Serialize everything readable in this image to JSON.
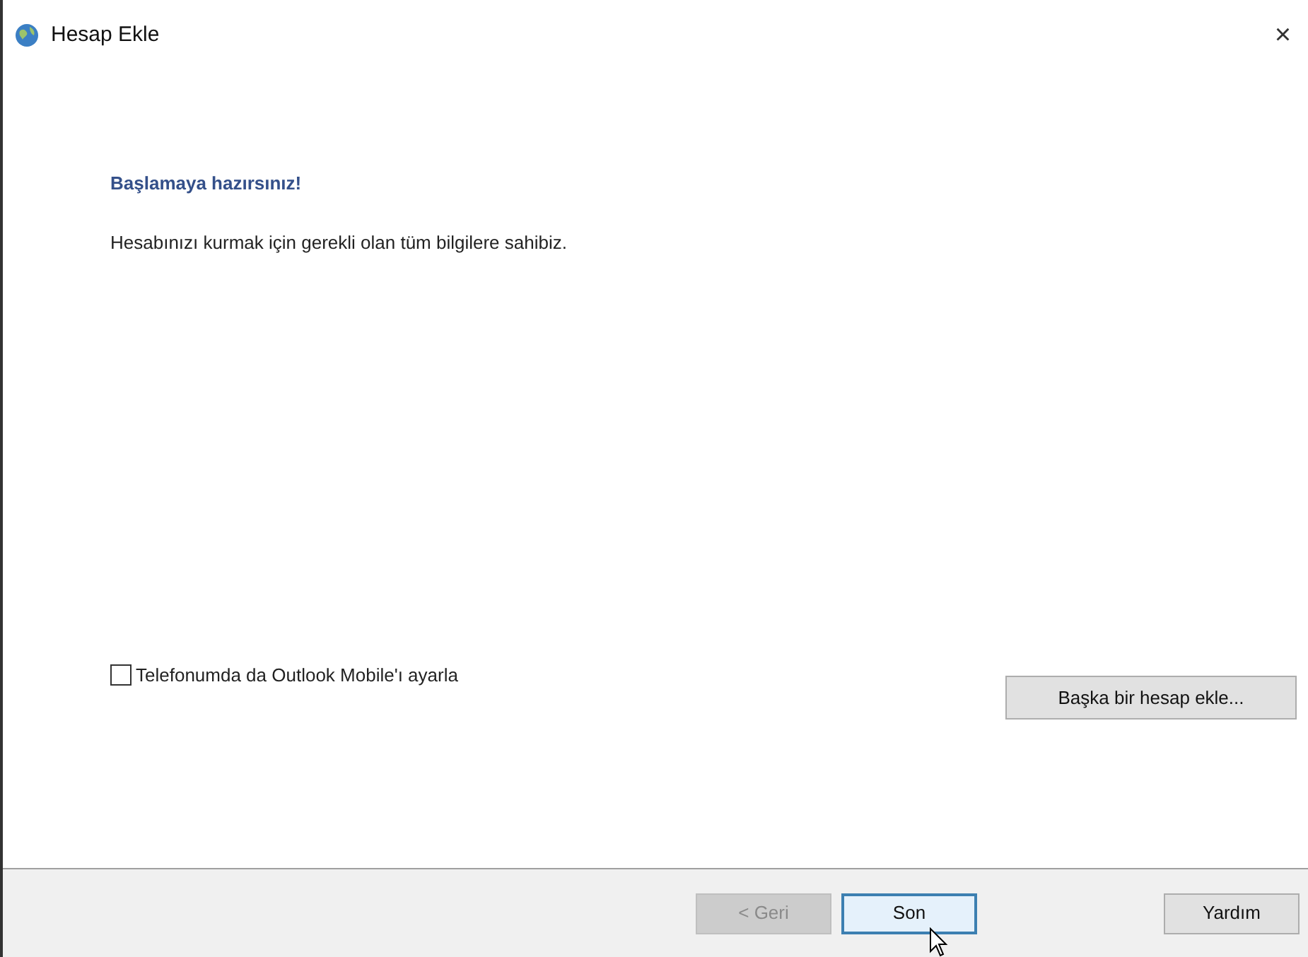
{
  "window": {
    "title": "Hesap Ekle",
    "close": "×"
  },
  "heading": "Başlamaya hazırsınız!",
  "message": "Hesabınızı kurmak için gerekli olan tüm bilgilere sahibiz.",
  "mobile_option": {
    "label": "Telefonumda da Outlook Mobile'ı ayarla",
    "checked": false
  },
  "add_another": "Başka bir hesap ekle...",
  "buttons": [
    {
      "label": "< Geri",
      "disabled": true,
      "focused": false
    },
    {
      "label": "Son",
      "disabled": false,
      "focused": true
    },
    {
      "label": "Yardım",
      "disabled": false,
      "focused": false
    }
  ]
}
